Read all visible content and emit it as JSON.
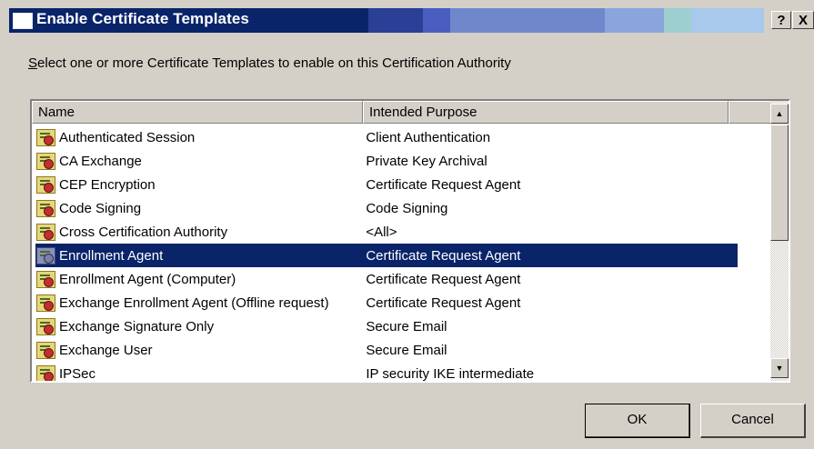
{
  "window": {
    "title": "Enable Certificate Templates",
    "help_label": "?",
    "close_label": "X"
  },
  "instruction": {
    "underlined_char": "S",
    "rest": "elect one or more Certificate Templates to enable on this Certification Authority"
  },
  "list": {
    "columns": {
      "name": "Name",
      "purpose": "Intended Purpose"
    },
    "rows": [
      {
        "name": "Authenticated Session",
        "purpose": "Client Authentication",
        "selected": false
      },
      {
        "name": "CA Exchange",
        "purpose": "Private Key Archival",
        "selected": false
      },
      {
        "name": "CEP Encryption",
        "purpose": "Certificate Request Agent",
        "selected": false
      },
      {
        "name": "Code Signing",
        "purpose": "Code Signing",
        "selected": false
      },
      {
        "name": "Cross Certification Authority",
        "purpose": "<All>",
        "selected": false
      },
      {
        "name": "Enrollment Agent",
        "purpose": "Certificate Request Agent",
        "selected": true
      },
      {
        "name": "Enrollment Agent (Computer)",
        "purpose": "Certificate Request Agent",
        "selected": false
      },
      {
        "name": "Exchange Enrollment Agent (Offline request)",
        "purpose": "Certificate Request Agent",
        "selected": false
      },
      {
        "name": "Exchange Signature Only",
        "purpose": "Secure Email",
        "selected": false
      },
      {
        "name": "Exchange User",
        "purpose": "Secure Email",
        "selected": false
      },
      {
        "name": "IPSec",
        "purpose": "IP security IKE intermediate",
        "selected": false
      }
    ]
  },
  "buttons": {
    "ok": "OK",
    "cancel": "Cancel"
  },
  "colors": {
    "selection": "#0a246a",
    "title_gradient": [
      "#0a246a",
      "#1a3a8a",
      "#3e5aa8",
      "#6d80c8",
      "#8fa0d8",
      "#a6caf0"
    ]
  },
  "icons": {
    "row_icon": "certificate-template-icon"
  }
}
